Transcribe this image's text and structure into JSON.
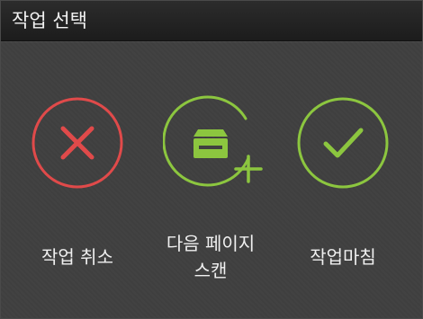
{
  "dialog": {
    "title": "작업 선택"
  },
  "actions": [
    {
      "id": "cancel",
      "label": "작업 취소",
      "icon": "x-circle-icon",
      "color": "#e04a4a"
    },
    {
      "id": "scan-next",
      "label_line1": "다음 페이지",
      "label_line2": "스캔",
      "icon": "scan-add-page-icon",
      "color": "#8cc63f"
    },
    {
      "id": "finish",
      "label": "작업마침",
      "icon": "check-circle-icon",
      "color": "#8cc63f"
    }
  ]
}
